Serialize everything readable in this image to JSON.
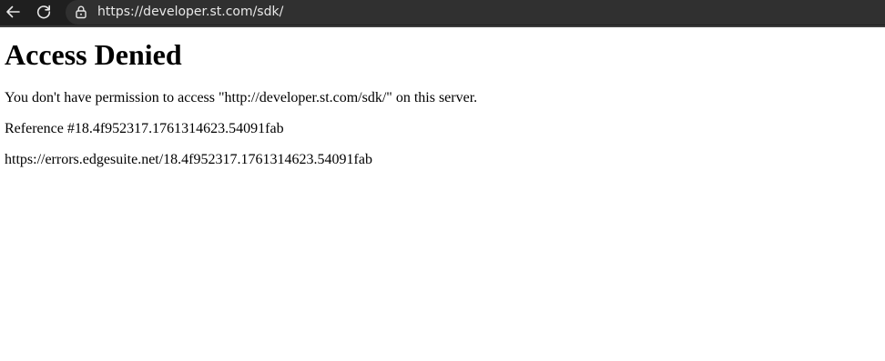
{
  "browser": {
    "url": "https://developer.st.com/sdk/",
    "icons": {
      "back": "arrow-left-icon",
      "reload": "reload-icon",
      "security": "lock-icon"
    }
  },
  "page": {
    "title": "Access Denied",
    "message": "You don't have permission to access \"http://developer.st.com/sdk/\" on this server.",
    "reference": "Reference #18.4f952317.1761314623.54091fab",
    "error_url": "https://errors.edgesuite.net/18.4f952317.1761314623.54091fab"
  }
}
